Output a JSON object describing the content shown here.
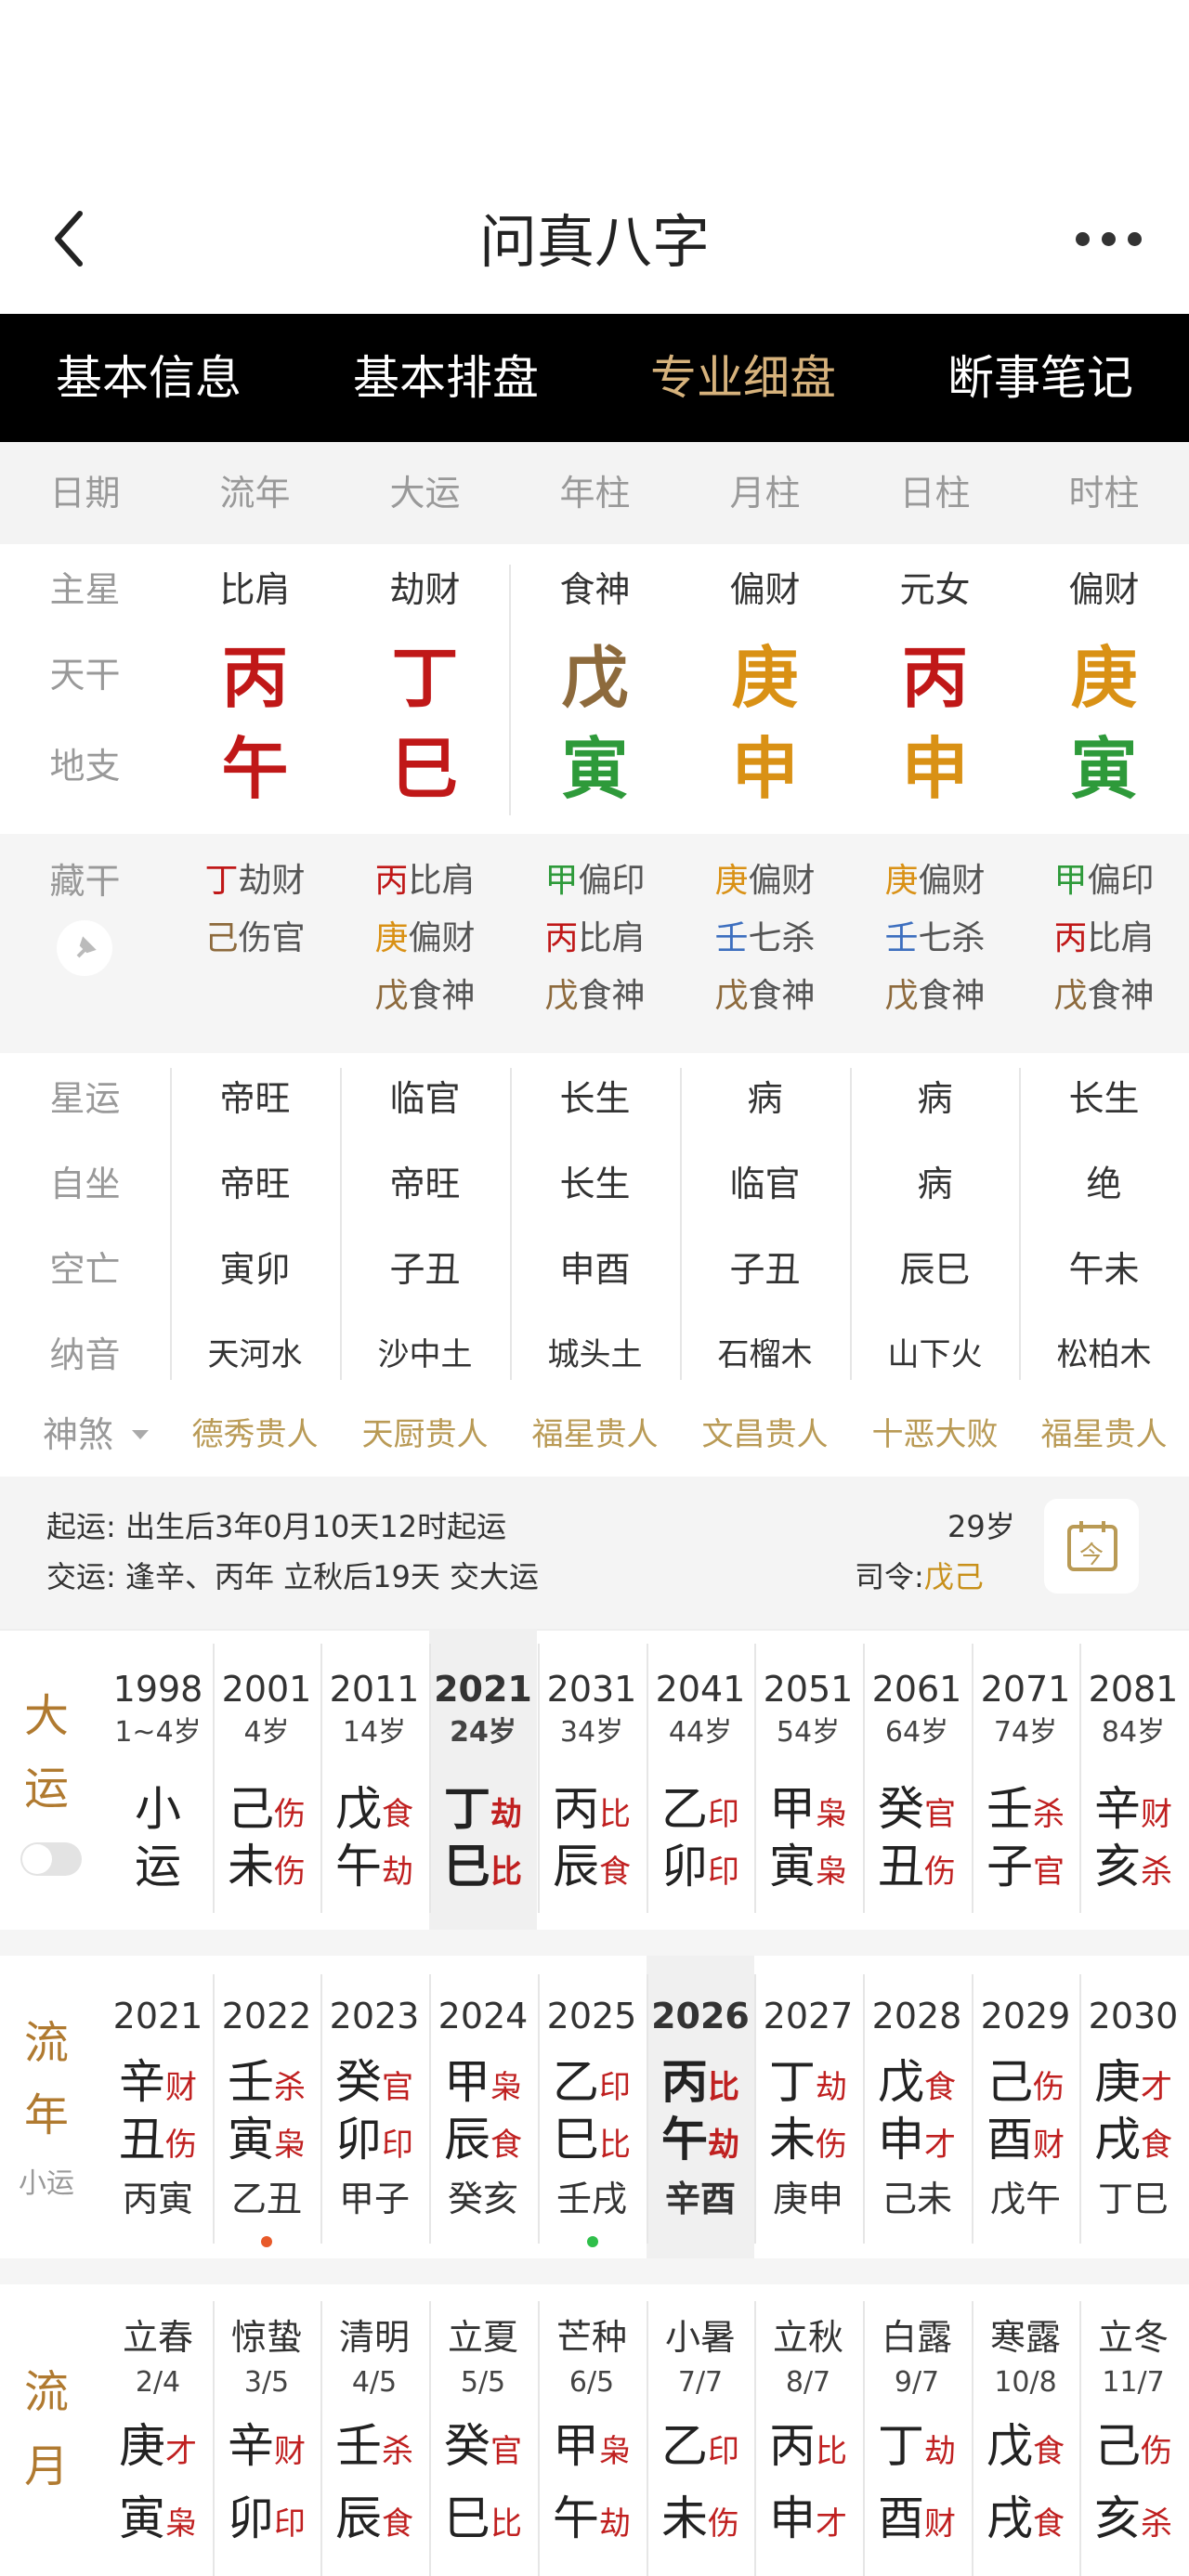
{
  "header": {
    "title": "问真八字"
  },
  "tabs": [
    "基本信息",
    "基本排盘",
    "专业细盘",
    "断事笔记"
  ],
  "columns": [
    "日期",
    "流年",
    "大运",
    "年柱",
    "月柱",
    "日柱",
    "时柱"
  ],
  "main_rows": {
    "labels": [
      "主星",
      "天干",
      "地支"
    ],
    "zhuxing": [
      "比肩",
      "劫财",
      "食神",
      "偏财",
      "元女",
      "偏财"
    ],
    "tiangan": [
      "丙",
      "丁",
      "戊",
      "庚",
      "丙",
      "庚"
    ],
    "dizhi": [
      "午",
      "巳",
      "寅",
      "申",
      "申",
      "寅"
    ],
    "colors": {
      "fire": "#c01818",
      "earth": "#8d6a3c",
      "metal": "#d99115",
      "wood": "#2e9a3a",
      "water": "#3d6fbf"
    }
  },
  "canggan": {
    "label": "藏干",
    "columns": [
      [
        {
          "g": "丁",
          "s": "劫财"
        },
        {
          "g": "己",
          "s": "伤官"
        }
      ],
      [
        {
          "g": "丙",
          "s": "比肩"
        },
        {
          "g": "庚",
          "s": "偏财"
        },
        {
          "g": "戊",
          "s": "食神"
        }
      ],
      [
        {
          "g": "甲",
          "s": "偏印"
        },
        {
          "g": "丙",
          "s": "比肩"
        },
        {
          "g": "戊",
          "s": "食神"
        }
      ],
      [
        {
          "g": "庚",
          "s": "偏财"
        },
        {
          "g": "壬",
          "s": "七杀"
        },
        {
          "g": "戊",
          "s": "食神"
        }
      ],
      [
        {
          "g": "庚",
          "s": "偏财"
        },
        {
          "g": "壬",
          "s": "七杀"
        },
        {
          "g": "戊",
          "s": "食神"
        }
      ],
      [
        {
          "g": "甲",
          "s": "偏印"
        },
        {
          "g": "丙",
          "s": "比肩"
        },
        {
          "g": "戊",
          "s": "食神"
        }
      ]
    ]
  },
  "info_rows": [
    {
      "label": "星运",
      "values": [
        "帝旺",
        "临官",
        "长生",
        "病",
        "病",
        "长生"
      ]
    },
    {
      "label": "自坐",
      "values": [
        "帝旺",
        "帝旺",
        "长生",
        "临官",
        "病",
        "绝"
      ]
    },
    {
      "label": "空亡",
      "values": [
        "寅卯",
        "子丑",
        "申酉",
        "子丑",
        "辰巳",
        "午未"
      ]
    },
    {
      "label": "纳音",
      "values": [
        "天河水",
        "沙中土",
        "城头土",
        "石榴木",
        "山下火",
        "松柏木"
      ]
    }
  ],
  "shensha": {
    "label": "神煞",
    "values": [
      "德秀贵人",
      "天厨贵人",
      "福星贵人",
      "文昌贵人",
      "十恶大败",
      "福星贵人"
    ]
  },
  "qiyun": {
    "line1_label": "起运:",
    "line1_text": "出生后3年0月10天12时起运",
    "line2_label": "交运:",
    "line2_text": "逢辛、丙年 立秋后19天 交大运",
    "age": "29岁",
    "siling_label": "司令:",
    "siling_value": "戊己",
    "icon_char": "今"
  },
  "dayun": {
    "label": [
      "大",
      "运"
    ],
    "items": [
      {
        "year": "1998",
        "age": "1~4岁",
        "g": "小",
        "gt": "",
        "z": "运",
        "zt": ""
      },
      {
        "year": "2001",
        "age": "4岁",
        "g": "己",
        "gt": "伤",
        "z": "未",
        "zt": "伤"
      },
      {
        "year": "2011",
        "age": "14岁",
        "g": "戊",
        "gt": "食",
        "z": "午",
        "zt": "劫"
      },
      {
        "year": "2021",
        "age": "24岁",
        "g": "丁",
        "gt": "劫",
        "z": "巳",
        "zt": "比"
      },
      {
        "year": "2031",
        "age": "34岁",
        "g": "丙",
        "gt": "比",
        "z": "辰",
        "zt": "食"
      },
      {
        "year": "2041",
        "age": "44岁",
        "g": "乙",
        "gt": "印",
        "z": "卯",
        "zt": "印"
      },
      {
        "year": "2051",
        "age": "54岁",
        "g": "甲",
        "gt": "枭",
        "z": "寅",
        "zt": "枭"
      },
      {
        "year": "2061",
        "age": "64岁",
        "g": "癸",
        "gt": "官",
        "z": "丑",
        "zt": "伤"
      },
      {
        "year": "2071",
        "age": "74岁",
        "g": "壬",
        "gt": "杀",
        "z": "子",
        "zt": "官"
      },
      {
        "year": "2081",
        "age": "84岁",
        "g": "辛",
        "gt": "财",
        "z": "亥",
        "zt": "杀"
      }
    ]
  },
  "liunian": {
    "label": [
      "流",
      "年"
    ],
    "sub": "小运",
    "items": [
      {
        "year": "2021",
        "g": "辛",
        "gt": "财",
        "z": "丑",
        "zt": "伤",
        "x": "丙寅"
      },
      {
        "year": "2022",
        "g": "壬",
        "gt": "杀",
        "z": "寅",
        "zt": "枭",
        "x": "乙丑"
      },
      {
        "year": "2023",
        "g": "癸",
        "gt": "官",
        "z": "卯",
        "zt": "印",
        "x": "甲子"
      },
      {
        "year": "2024",
        "g": "甲",
        "gt": "枭",
        "z": "辰",
        "zt": "食",
        "x": "癸亥"
      },
      {
        "year": "2025",
        "g": "乙",
        "gt": "印",
        "z": "巳",
        "zt": "比",
        "x": "壬戌"
      },
      {
        "year": "2026",
        "g": "丙",
        "gt": "比",
        "z": "午",
        "zt": "劫",
        "x": "辛酉"
      },
      {
        "year": "2027",
        "g": "丁",
        "gt": "劫",
        "z": "未",
        "zt": "伤",
        "x": "庚申"
      },
      {
        "year": "2028",
        "g": "戊",
        "gt": "食",
        "z": "申",
        "zt": "才",
        "x": "己未"
      },
      {
        "year": "2029",
        "g": "己",
        "gt": "伤",
        "z": "酉",
        "zt": "财",
        "x": "戊午"
      },
      {
        "year": "2030",
        "g": "庚",
        "gt": "才",
        "z": "戌",
        "zt": "食",
        "x": "丁巳"
      }
    ]
  },
  "liuyue": {
    "label": [
      "流",
      "月"
    ],
    "items": [
      {
        "term": "立春",
        "date": "2/4",
        "g": "庚",
        "gt": "才",
        "z": "寅",
        "zt": "枭"
      },
      {
        "term": "惊蛰",
        "date": "3/5",
        "g": "辛",
        "gt": "财",
        "z": "卯",
        "zt": "印"
      },
      {
        "term": "清明",
        "date": "4/5",
        "g": "壬",
        "gt": "杀",
        "z": "辰",
        "zt": "食"
      },
      {
        "term": "立夏",
        "date": "5/5",
        "g": "癸",
        "gt": "官",
        "z": "巳",
        "zt": "比"
      },
      {
        "term": "芒种",
        "date": "6/5",
        "g": "甲",
        "gt": "枭",
        "z": "午",
        "zt": "劫"
      },
      {
        "term": "小暑",
        "date": "7/7",
        "g": "乙",
        "gt": "印",
        "z": "未",
        "zt": "伤"
      },
      {
        "term": "立秋",
        "date": "8/7",
        "g": "丙",
        "gt": "比",
        "z": "申",
        "zt": "才"
      },
      {
        "term": "白露",
        "date": "9/7",
        "g": "丁",
        "gt": "劫",
        "z": "酉",
        "zt": "财"
      },
      {
        "term": "寒露",
        "date": "10/8",
        "g": "戊",
        "gt": "食",
        "z": "戌",
        "zt": "食"
      },
      {
        "term": "立冬",
        "date": "11/7",
        "g": "己",
        "gt": "伤",
        "z": "亥",
        "zt": "杀"
      }
    ]
  }
}
